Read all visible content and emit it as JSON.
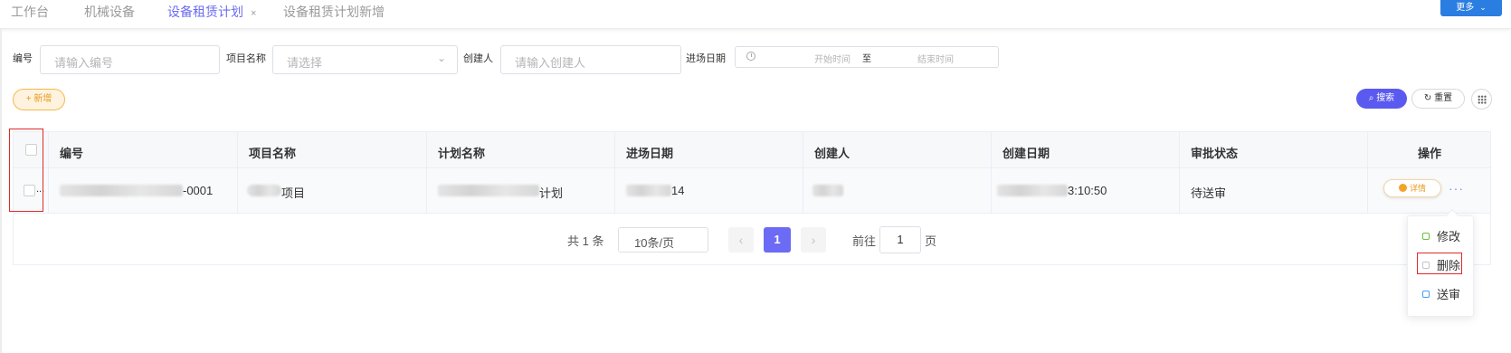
{
  "tabs": [
    {
      "label": "工作台"
    },
    {
      "label": "机械设备"
    },
    {
      "label": "设备租赁计划",
      "active": true,
      "close": "×"
    },
    {
      "label": "设备租赁计划新增"
    }
  ],
  "more_button": {
    "label": "更多",
    "icon": "chevron-down-icon"
  },
  "filters": {
    "code": {
      "label": "编号",
      "placeholder": "请输入编号"
    },
    "project": {
      "label": "项目名称",
      "placeholder": "请选择"
    },
    "creator": {
      "label": "创建人",
      "placeholder": "请输入创建人"
    },
    "entry_date": {
      "label": "进场日期",
      "start_placeholder": "开始时间",
      "separator": "至",
      "end_placeholder": "结束时间"
    }
  },
  "actions": {
    "add": "+ 新增",
    "search": "搜索",
    "reset": "重置"
  },
  "table": {
    "columns": [
      "编号",
      "项目名称",
      "计划名称",
      "进场日期",
      "创建人",
      "创建日期",
      "审批状态",
      "操作"
    ],
    "rows": [
      {
        "code_suffix": "-0001",
        "project_suffix": "项目",
        "plan_suffix": "计划",
        "entry_suffix": "14",
        "created_suffix": "3:10:50",
        "status": "待送审",
        "checkbox_ellipsis": "...",
        "detail_label": "详情",
        "more_ops": "···"
      }
    ]
  },
  "pagination": {
    "total": "共 1 条",
    "page_size": "10条/页",
    "prev": "‹",
    "current": "1",
    "next": "›",
    "goto_label": "前往",
    "goto_value": "1",
    "page_label": "页"
  },
  "row_menu": {
    "items": [
      {
        "label": "修改",
        "icon": "edit-icon"
      },
      {
        "label": "删除",
        "icon": "delete-icon"
      },
      {
        "label": "送审",
        "icon": "send-icon"
      }
    ]
  },
  "colors": {
    "accent": "#6b6bf5",
    "highlight": "#e02a2a",
    "add": "#e89a1c"
  }
}
